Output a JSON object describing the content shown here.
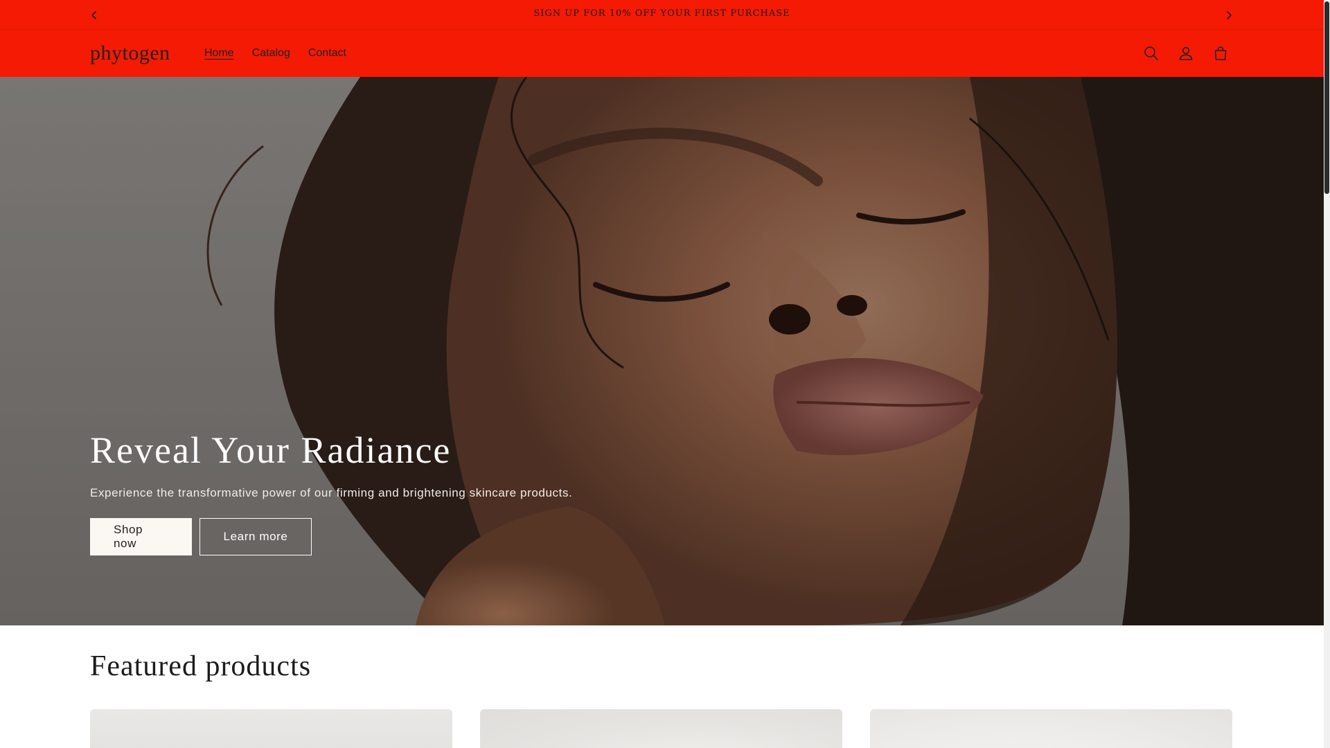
{
  "announcement": {
    "text": "SIGN UP FOR 10% OFF YOUR FIRST PURCHASE",
    "prev_icon": "chevron-left-icon",
    "next_icon": "chevron-right-icon"
  },
  "header": {
    "logo": "phytogen",
    "nav": [
      {
        "label": "Home",
        "active": true
      },
      {
        "label": "Catalog",
        "active": false
      },
      {
        "label": "Contact",
        "active": false
      }
    ],
    "icons": [
      "search-icon",
      "account-icon",
      "cart-icon"
    ],
    "background_color": "#f41a04"
  },
  "hero": {
    "title": "Reveal Your Radiance",
    "subtitle": "Experience the transformative power of our firming and brightening skincare products.",
    "primary_button": "Shop now",
    "secondary_button": "Learn more"
  },
  "featured": {
    "title": "Featured products",
    "cards": [
      "product-card-1",
      "product-card-2",
      "product-card-3"
    ]
  }
}
